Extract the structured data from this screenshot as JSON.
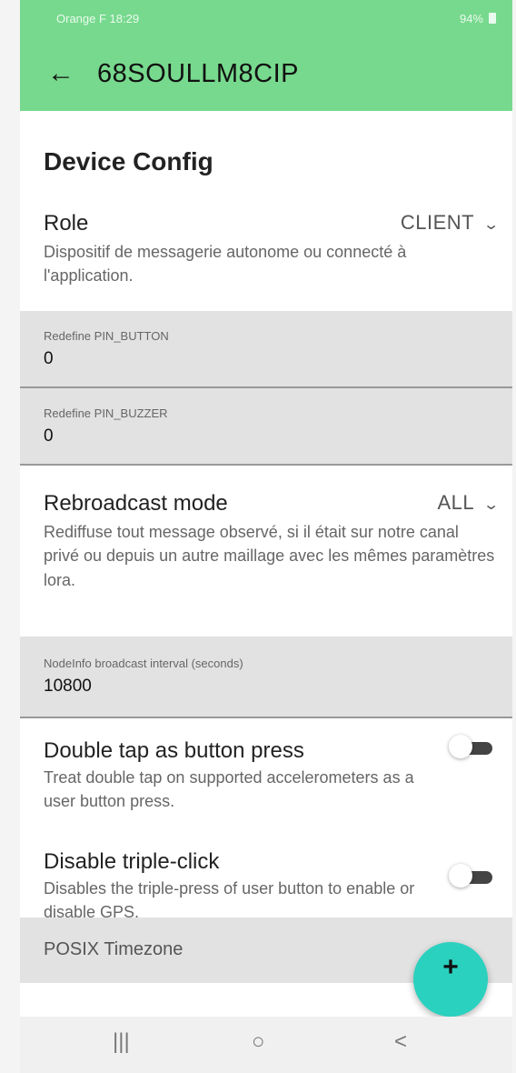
{
  "status_bar": {
    "left": "Orange F 18:29",
    "right": "94%"
  },
  "appbar": {
    "back_icon": "arrow-left-icon",
    "title": "68SOULLM8CIP"
  },
  "section": {
    "title": "Device Config"
  },
  "role": {
    "label": "Role",
    "value": "CLIENT",
    "description": "Dispositif de messagerie autonome ou connecté à l'application."
  },
  "pin_button": {
    "label": "Redefine PIN_BUTTON",
    "value": "0"
  },
  "pin_buzzer": {
    "label": "Redefine PIN_BUZZER",
    "value": "0"
  },
  "rebroadcast": {
    "label": "Rebroadcast mode",
    "value": "ALL",
    "description": "Rediffuse tout message observé, si il était sur notre canal privé ou depuis un autre maillage avec les mêmes paramètres lora."
  },
  "nodeinfo": {
    "label": "NodeInfo broadcast interval (seconds)",
    "value": "10800"
  },
  "double_tap": {
    "label": "Double tap as button press",
    "description": "Treat double tap on supported accelerometers as a user button press.",
    "enabled": false
  },
  "triple_click": {
    "label": "Disable triple-click",
    "description": "Disables the triple-press of user button to enable or disable GPS.",
    "enabled": false
  },
  "posix": {
    "label": "POSIX Timezone"
  },
  "fab": {
    "label": "+"
  },
  "nav": {
    "recent": "|||",
    "home": "○",
    "back": "<"
  },
  "colors": {
    "appbar": "#77d98d",
    "fab": "#2ad1bf",
    "field_bg": "#e2e2e2"
  }
}
